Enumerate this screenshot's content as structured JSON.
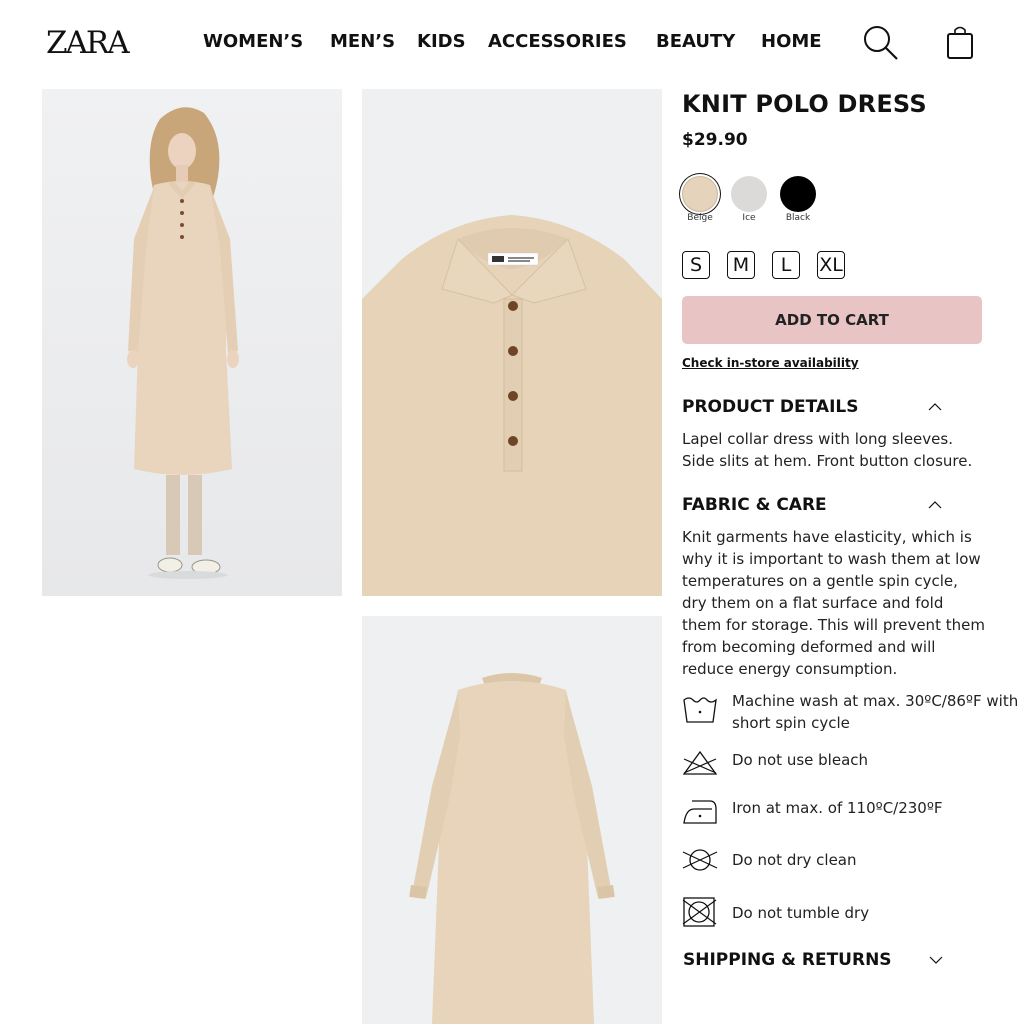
{
  "header": {
    "logo": "ZARA",
    "nav": [
      "WOMEN’S",
      "MEN’S",
      "KIDS",
      "ACCESSORIES",
      "BEAUTY",
      "HOME"
    ],
    "icons": [
      "search-icon",
      "shopping-bag-icon"
    ]
  },
  "gallery": [
    {
      "name": "model-front-photo"
    },
    {
      "name": "collar-detail-photo"
    },
    {
      "name": "back-view-photo"
    }
  ],
  "product": {
    "title": "KNIT POLO DRESS",
    "price": "$29.90",
    "colors": [
      {
        "label": "Beige",
        "hex": "#e5d3bb",
        "selected": true
      },
      {
        "label": "Ice",
        "hex": "#dcdad8",
        "selected": false
      },
      {
        "label": "Black",
        "hex": "#000000",
        "selected": false
      }
    ],
    "sizes": [
      "S",
      "M",
      "L",
      "XL"
    ],
    "add_to_cart": "ADD TO CART",
    "store_link": "Check in-store availability"
  },
  "details": {
    "heading": "PRODUCT DETAILS",
    "text": "Lapel collar dress with long sleeves. Side slits at hem. Front button closure.",
    "expanded": true
  },
  "fabric": {
    "heading": "FABRIC & CARE",
    "text": "Knit garments have elasticity, which is why it is important to wash them at low temperatures on a gentle spin cycle, dry them on a flat surface and fold them for storage. This will prevent them from becoming deformed and will reduce energy consumption.",
    "expanded": true,
    "care": [
      {
        "icon": "wash-tub-icon",
        "text": "Machine wash at max. 30ºC/86ºF with short spin cycle"
      },
      {
        "icon": "no-bleach-icon",
        "text": "Do not use bleach"
      },
      {
        "icon": "iron-icon",
        "text": "Iron at max. of 110ºC/230ºF"
      },
      {
        "icon": "no-dry-clean-icon",
        "text": "Do not dry clean"
      },
      {
        "icon": "no-tumble-dry-icon",
        "text": "Do not tumble dry"
      }
    ]
  },
  "shipping": {
    "heading": "SHIPPING & RETURNS",
    "expanded": false
  }
}
